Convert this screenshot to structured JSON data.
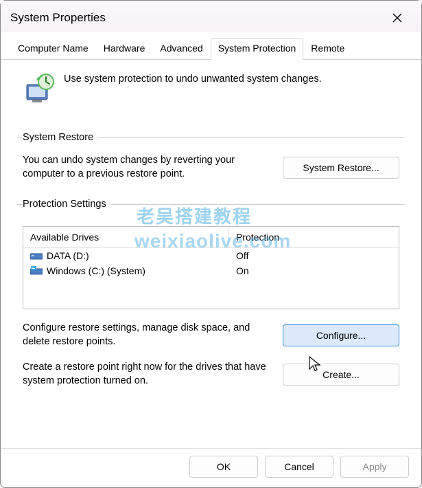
{
  "window": {
    "title": "System Properties"
  },
  "tabs": {
    "computer_name": "Computer Name",
    "hardware": "Hardware",
    "advanced": "Advanced",
    "system_protection": "System Protection",
    "remote": "Remote",
    "active": "system_protection"
  },
  "intro": "Use system protection to undo unwanted system changes.",
  "restore": {
    "legend": "System Restore",
    "text": "You can undo system changes by reverting your computer to a previous restore point.",
    "button": "System Restore..."
  },
  "protection": {
    "legend": "Protection Settings",
    "header_drive": "Available Drives",
    "header_protection": "Protection",
    "drives": [
      {
        "name": "DATA (D:)",
        "protection": "Off",
        "icon": "drive"
      },
      {
        "name": "Windows (C:) (System)",
        "protection": "On",
        "icon": "system-drive"
      }
    ],
    "configure_text": "Configure restore settings, manage disk space, and delete restore points.",
    "configure_button": "Configure...",
    "create_text": "Create a restore point right now for the drives that have system protection turned on.",
    "create_button": "Create..."
  },
  "footer": {
    "ok": "OK",
    "cancel": "Cancel",
    "apply": "Apply"
  },
  "watermark": {
    "line1": "老吴搭建教程",
    "line2": "weixiaolive.com"
  }
}
